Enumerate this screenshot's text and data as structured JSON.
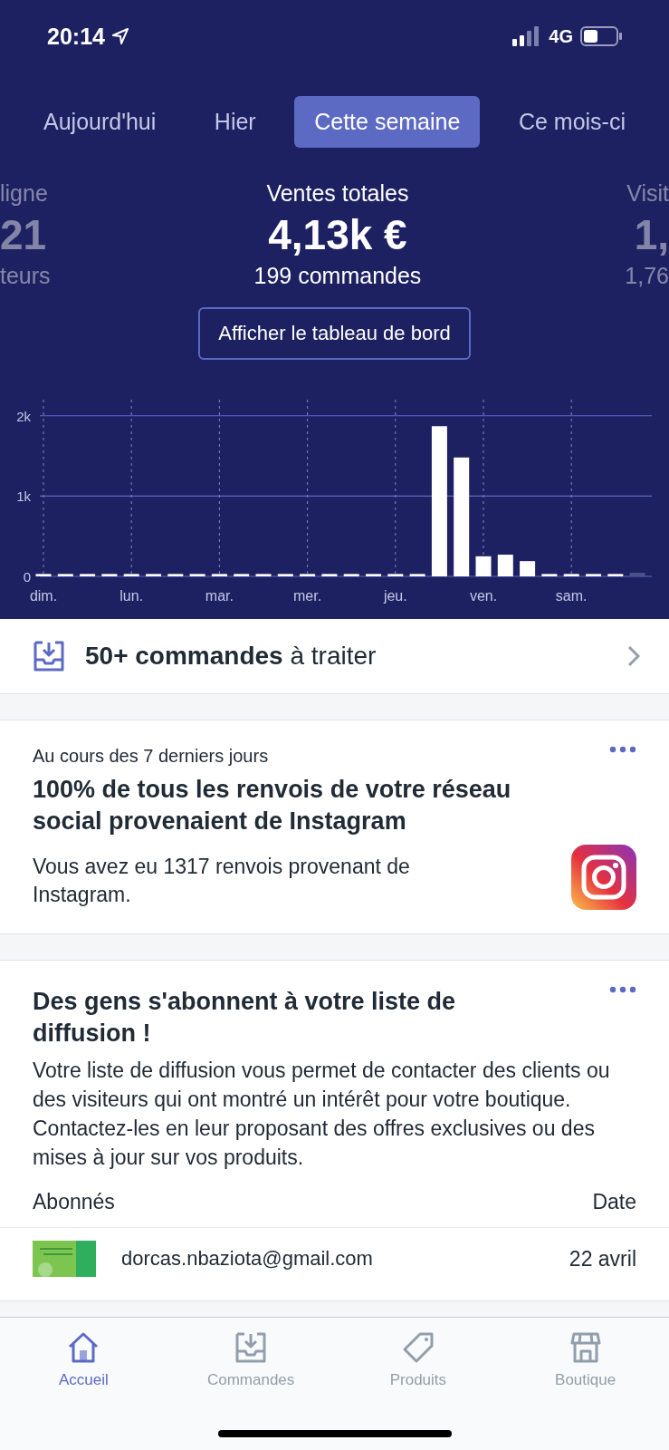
{
  "status_bar": {
    "time": "20:14",
    "network": "4G"
  },
  "tabs": [
    {
      "label": "Aujourd'hui",
      "selected": false
    },
    {
      "label": "Hier",
      "selected": false
    },
    {
      "label": "Cette semaine",
      "selected": true
    },
    {
      "label": "Ce mois-ci",
      "selected": false
    }
  ],
  "stats": [
    {
      "label": "ligne",
      "value": "21",
      "sub": "teurs",
      "kind": "left"
    },
    {
      "label": "Ventes totales",
      "value": "4,13k €",
      "sub": "199 commandes",
      "kind": "center"
    },
    {
      "label": "Visit",
      "value": "1,",
      "sub": "1,76",
      "kind": "right"
    }
  ],
  "dashboard_button": "Afficher le tableau de bord",
  "chart_data": {
    "type": "bar",
    "categories": [
      "dim.",
      null,
      null,
      null,
      "lun.",
      null,
      null,
      null,
      "mar.",
      null,
      null,
      null,
      "mer.",
      null,
      null,
      null,
      "jeu.",
      null,
      null,
      null,
      "ven.",
      null,
      null,
      null,
      "sam.",
      null,
      null,
      null
    ],
    "values": [
      30,
      30,
      30,
      30,
      30,
      30,
      30,
      30,
      30,
      30,
      30,
      30,
      30,
      30,
      30,
      30,
      30,
      30,
      1870,
      1480,
      250,
      270,
      190,
      30,
      30,
      30,
      30,
      null
    ],
    "grid": true,
    "ylim": [
      0,
      2200
    ],
    "yticks": [
      {
        "value": 0,
        "label": "0"
      },
      {
        "value": 1000,
        "label": "1k"
      },
      {
        "value": 2000,
        "label": "2k"
      }
    ]
  },
  "orders_row": {
    "text": "**50+ commandes** à traiter"
  },
  "cards": [
    {
      "kind": "insight",
      "eyebrow": "Au cours des 7 derniers jours",
      "title": "100% de tous les renvois de votre réseau social provenaient de Instagram",
      "body": "Vous avez eu 1317 renvois provenant de Instagram."
    },
    {
      "kind": "subscribers",
      "title": "Des gens s'abonnent à votre liste de diffusion !",
      "body": "Votre liste de diffusion vous permet de contacter des clients ou des visiteurs qui ont montré un intérêt pour votre boutique. Contactez-les en leur proposant des offres exclusives ou des mises à jour sur vos produits.",
      "columns": [
        "Abonnés",
        "Date"
      ],
      "rows": [
        {
          "email": "dorcas.nbaziota@gmail.com",
          "date": "22 avril"
        }
      ]
    }
  ],
  "nav": [
    {
      "label": "Accueil",
      "kind": "home",
      "selected": true
    },
    {
      "label": "Commandes",
      "kind": "inbox",
      "selected": false
    },
    {
      "label": "Produits",
      "kind": "tag",
      "selected": false
    },
    {
      "label": "Boutique",
      "kind": "store",
      "selected": false
    }
  ]
}
